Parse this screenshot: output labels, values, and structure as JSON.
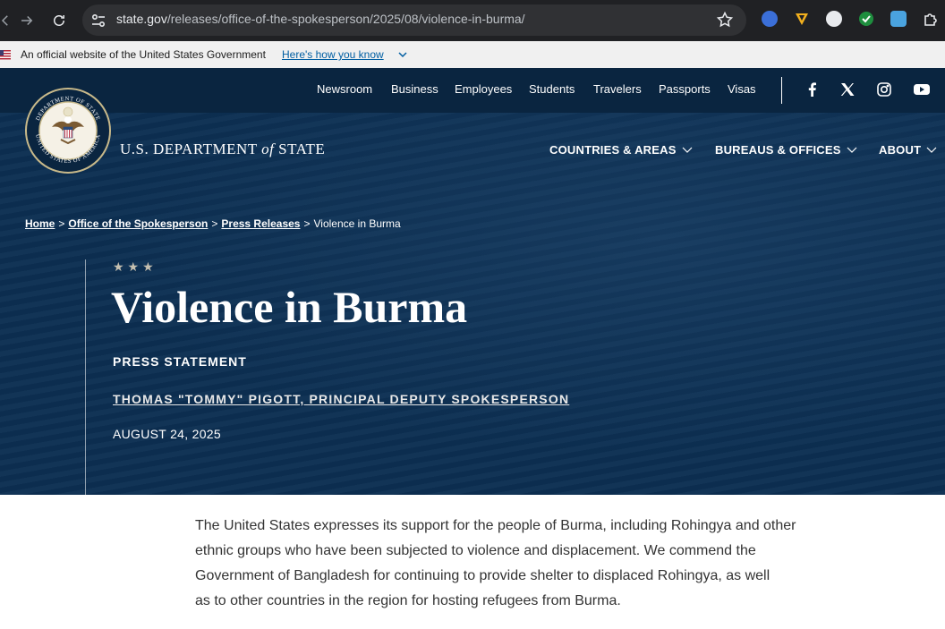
{
  "browser": {
    "url_host": "state.gov",
    "url_path": "/releases/office-of-the-spokesperson/2025/08/violence-in-burma/"
  },
  "gov_banner": {
    "text": "An official website of the United States Government",
    "link": "Here's how you know"
  },
  "utility_nav": [
    "Newsroom",
    "Business",
    "Employees",
    "Students",
    "Travelers",
    "Passports",
    "Visas"
  ],
  "social": [
    "facebook-icon",
    "x-icon",
    "instagram-icon",
    "youtube-icon"
  ],
  "header": {
    "dept_prefix": "U.S. DEPARTMENT",
    "dept_of": "of",
    "dept_suffix": "STATE",
    "seal_text_top": "DEPARTMENT OF STATE",
    "seal_text_bottom": "UNITED STATES OF AMERICA",
    "main_nav": [
      "COUNTRIES & AREAS",
      "BUREAUS & OFFICES",
      "ABOUT"
    ]
  },
  "breadcrumb": {
    "items": [
      "Home",
      "Office of the Spokesperson",
      "Press Releases"
    ],
    "current": "Violence in Burma",
    "separator": ">"
  },
  "article": {
    "stars": "★★★",
    "title": "Violence in Burma",
    "type": "PRESS STATEMENT",
    "author": "THOMAS \"TOMMY\" PIGOTT, PRINCIPAL DEPUTY SPOKESPERSON",
    "date": "AUGUST 24, 2025",
    "body_lines": [
      "The United States expresses its support for the people of Burma, including Rohingya and other",
      "ethnic groups who have been subjected to violence and displacement. We commend the",
      "Government of Bangladesh for continuing to provide shelter to displaced Rohingya, as well",
      "as to other countries in the region for hosting refugees from Burma."
    ]
  },
  "colors": {
    "header_bg": "#0c2f52",
    "utility_bg": "#0a2540",
    "link_blue": "#005ea2"
  }
}
